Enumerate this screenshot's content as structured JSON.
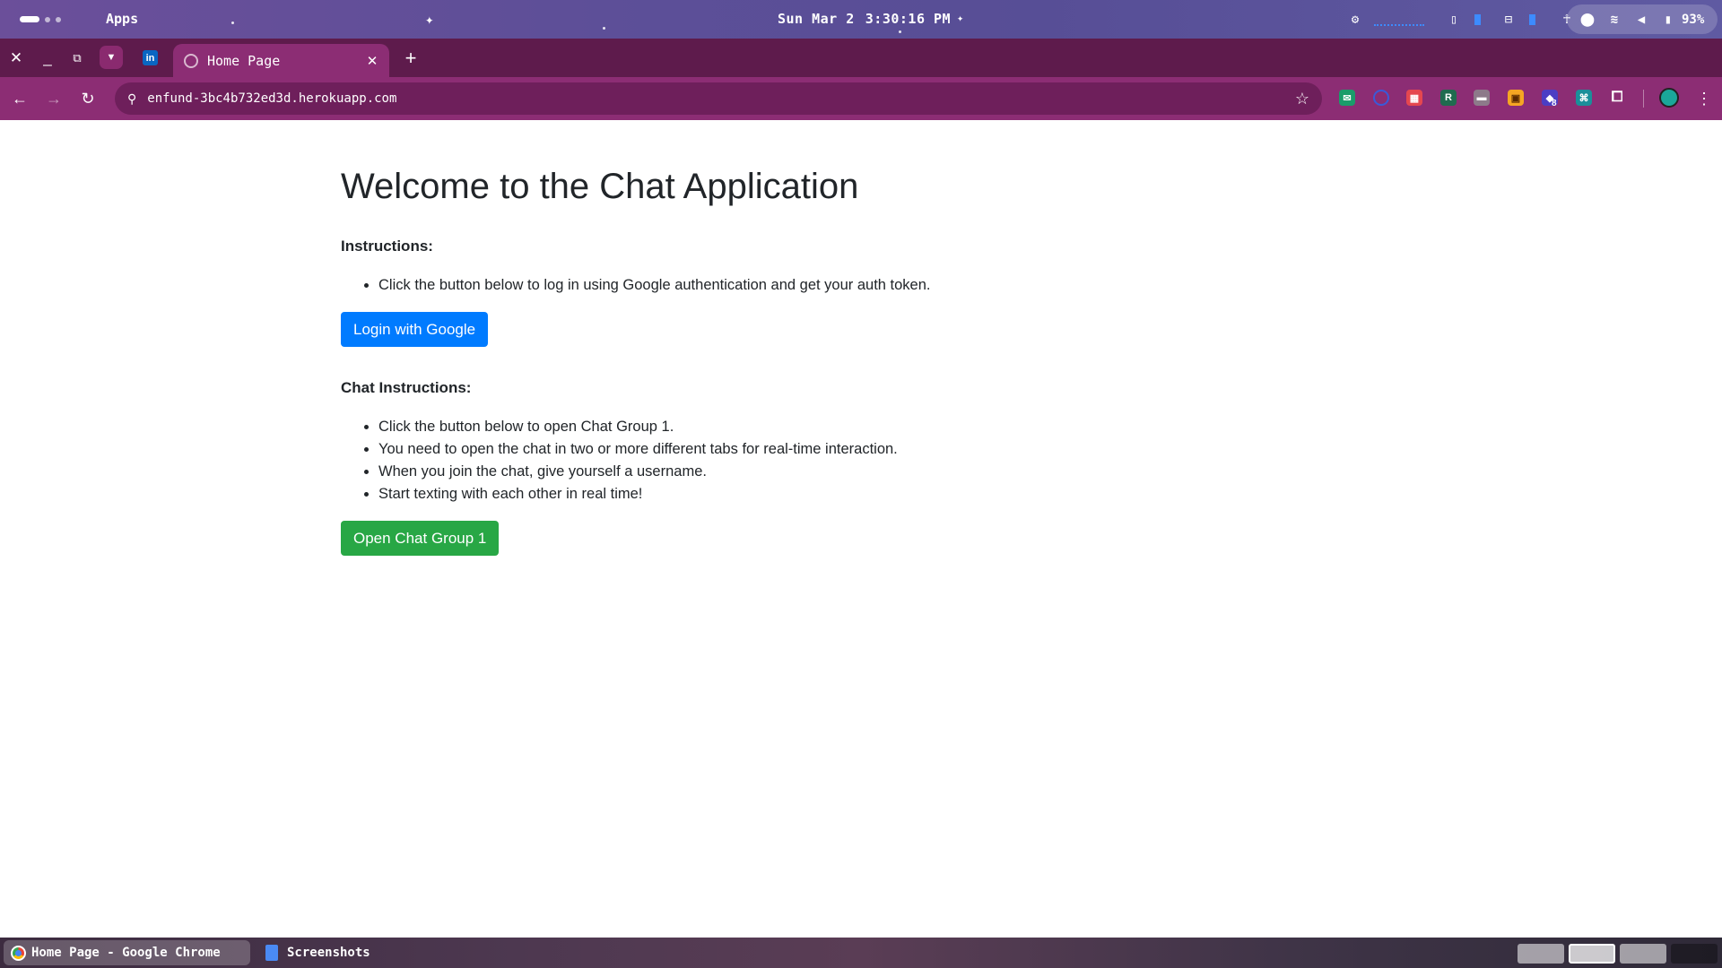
{
  "system_bar": {
    "apps_label": "Apps",
    "date": "Sun Mar 2",
    "time": "3:30:16 PM",
    "battery": "93%"
  },
  "tab_strip": {
    "active_tab_title": "Home Page",
    "pinned_tab_label": "in"
  },
  "toolbar": {
    "url": "enfund-3bc4b732ed3d.herokuapp.com",
    "extension_badge": "8"
  },
  "page": {
    "heading": "Welcome to the Chat Application",
    "instructions_heading": "Instructions:",
    "instructions": [
      "Click the button below to log in using Google authentication and get your auth token."
    ],
    "login_button": "Login with Google",
    "chat_heading": "Chat Instructions:",
    "chat_instructions": [
      "Click the button below to open Chat Group 1.",
      "You need to open the chat in two or more different tabs for real-time interaction.",
      "When you join the chat, give yourself a username.",
      "Start texting with each other in real time!"
    ],
    "chat_button": "Open Chat Group 1"
  },
  "shelf": {
    "items": [
      {
        "label": "Home Page - Google Chrome"
      },
      {
        "label": "Screenshots"
      }
    ]
  },
  "colors": {
    "primary_button": "#007bff",
    "success_button": "#28a745",
    "browser_frame": "#8c2d74"
  }
}
